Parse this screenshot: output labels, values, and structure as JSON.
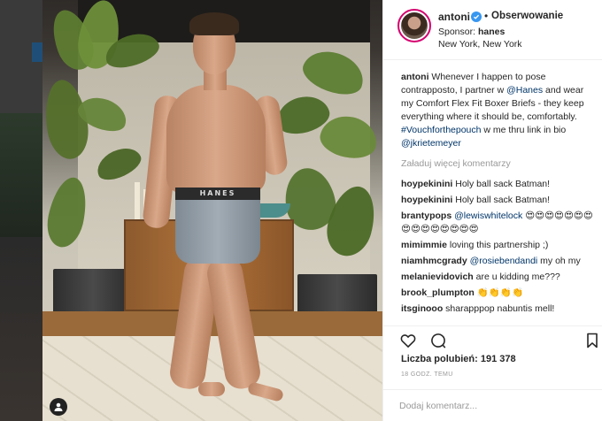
{
  "post": {
    "username": "antoni",
    "follow_label": "Obserwowanie",
    "sponsor_prefix": "Sponsor:",
    "sponsor_name": "hanes",
    "location": "New York, New York",
    "caption_user": "antoni",
    "caption_text_1": " Whenever I happen to pose contrapposto, I partner w ",
    "caption_mention_1": "@Hanes",
    "caption_text_2": " and wear my Comfort Flex Fit Boxer Briefs - they keep everything where it should be, comfortably. ",
    "caption_hashtag": "#Vouchforthepouch",
    "caption_text_3": " w me thru link in bio   ",
    "caption_mention_2": "@jkrietemeyer",
    "load_more": "Załaduj więcej komentarzy",
    "likes_label": "Liczba polubień: 191 378",
    "time": "18 GODZ. TEMU",
    "comment_placeholder": "Dodaj komentarz..."
  },
  "photo": {
    "waistband_text": "HANES"
  },
  "comments": [
    {
      "user": "hoypekinini",
      "text": " Holy ball sack Batman!"
    },
    {
      "user": "hoypekinini",
      "text": " Holy ball sack Batman!"
    },
    {
      "user": "brantypops",
      "mention": "@lewiswhitelock",
      "text": " 😍😍😍😍😍😍😍😍😍😍😍😍😍😍😍"
    },
    {
      "user": "mimimmie",
      "text": " loving this partnership ;)"
    },
    {
      "user": "niamhmcgrady",
      "mention": "@rosiebendandi",
      "text": " my oh my"
    },
    {
      "user": "melanievidovich",
      "text": " are u kidding me???"
    },
    {
      "user": "brook_plumpton",
      "text": " 👏👏👏👏"
    },
    {
      "user": "itsginooo",
      "text": " sharapppop nabuntis mell!"
    }
  ],
  "icons": {
    "verified": "verified-badge-icon",
    "like": "heart-icon",
    "comment": "comment-bubble-icon",
    "save": "bookmark-icon",
    "tag": "user-tag-icon"
  },
  "colors": {
    "verified": "#3897f0",
    "link": "#003569",
    "muted": "#999999",
    "avatar_ring": "#d4006e"
  }
}
